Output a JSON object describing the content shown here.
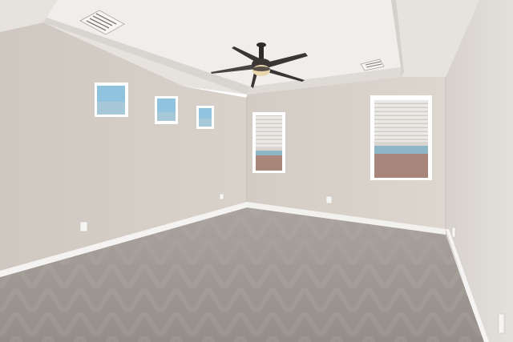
{
  "scene": {
    "subject": "empty-bedroom-interior",
    "colors": {
      "ceiling": "#e9e6e2",
      "tray_ceiling": "#f1efec",
      "tray_step": "#dcd8d2",
      "wall_left": "#d3cdc5",
      "wall_back": "#d9d3cb",
      "wall_right": "#dedad5",
      "carpet": "#9b948f",
      "carpet_light": "#aaa39e",
      "baseboard": "#f4f3f1",
      "window_frame": "#ffffff",
      "sky": "#8fc3de",
      "blind": "#e8e6e2",
      "fan_blade": "#3a3635",
      "fan_light": "#e9d6ac",
      "vent": "#c9c6c2",
      "outlet": "#f5f5f3"
    },
    "icons": [
      "ceiling-fan-icon",
      "vent-icon",
      "outlet-icon"
    ]
  }
}
